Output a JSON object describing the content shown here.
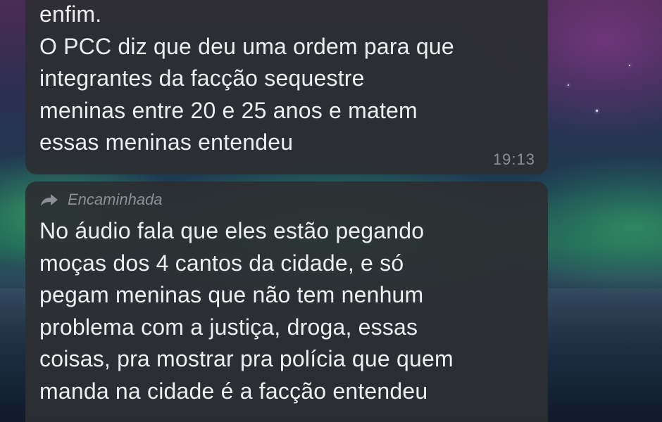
{
  "conversation": {
    "message_1": {
      "lines": [
        "enfim.",
        "O PCC diz que deu uma ordem para que",
        "integrantes da facção sequestre",
        "meninas entre 20 e 25 anos e matem",
        "essas meninas entendeu"
      ],
      "time": "19:13"
    },
    "message_2": {
      "forwarded_label": "Encaminhada",
      "forwarded_icon": "forward-arrow-icon",
      "lines": [
        "No áudio fala que eles estão pegando",
        "moças dos 4 cantos da cidade, e só",
        "pegam meninas que não tem nenhum",
        "problema com a justiça, droga, essas",
        "coisas, pra mostrar pra polícia que quem",
        "manda na cidade é a facção entendeu"
      ]
    }
  },
  "theme": {
    "bubble_color": "#2c2e32",
    "text_color": "#eceef0",
    "meta_color": "#8c8f94"
  }
}
